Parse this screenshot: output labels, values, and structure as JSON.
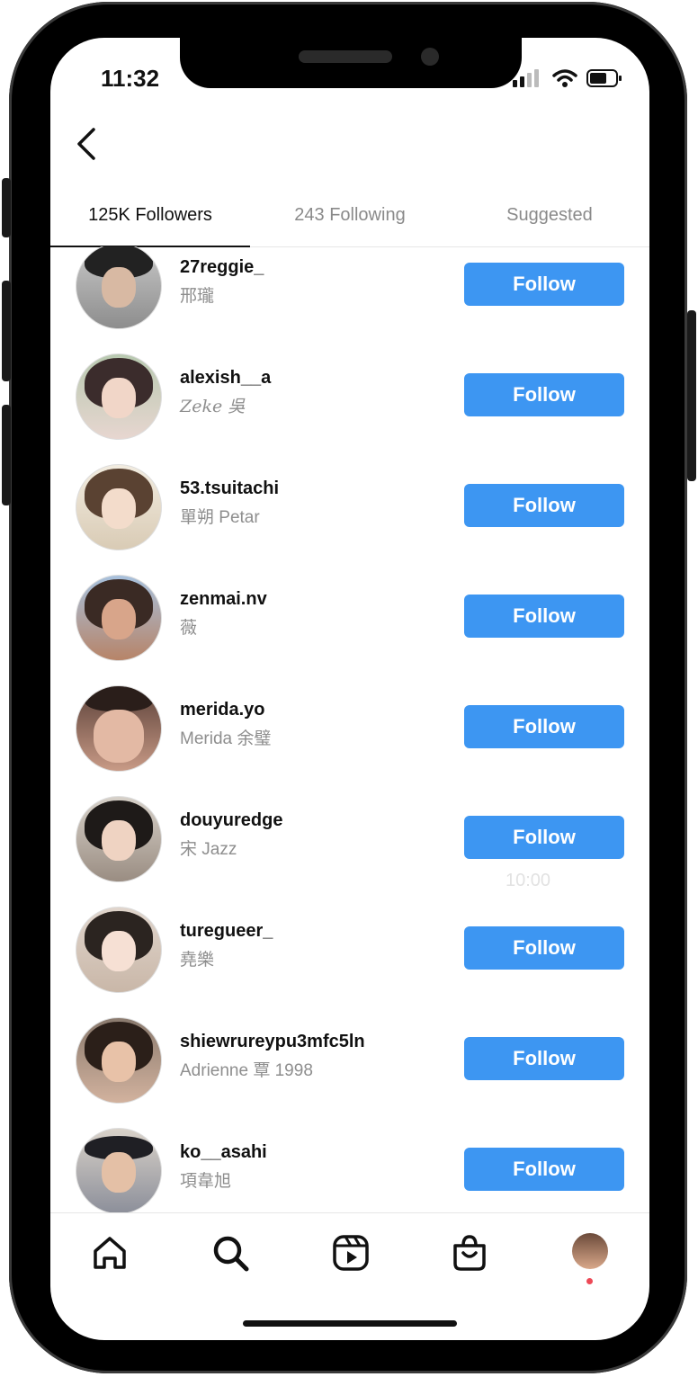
{
  "status_bar": {
    "time": "11:32"
  },
  "tabs": [
    {
      "label": "125K Followers",
      "active": true
    },
    {
      "label": "243 Following",
      "active": false
    },
    {
      "label": "Suggested",
      "active": false
    }
  ],
  "follow_label": "Follow",
  "ghost_overlay_text": "10:00",
  "rows": [
    {
      "username": "27reggie_",
      "fullname": "邢瓏"
    },
    {
      "username": "alexish__a",
      "fullname": "Zeke 吳"
    },
    {
      "username": "53.tsuitachi",
      "fullname": "單朔 Petar"
    },
    {
      "username": "zenmai.nv",
      "fullname": "薇"
    },
    {
      "username": "merida.yo",
      "fullname": "Merida 余璧"
    },
    {
      "username": "douyuredge",
      "fullname": "宋 Jazz"
    },
    {
      "username": "turegueer_",
      "fullname": "堯樂"
    },
    {
      "username": "shiewrureypu3mfc5ln",
      "fullname": "Adrienne 覃 1998"
    },
    {
      "username": "ko__asahi",
      "fullname": "項韋旭"
    }
  ],
  "icons": {
    "back": "chevron-left-icon",
    "signal": "cellular-signal-icon",
    "wifi": "wifi-icon",
    "battery": "battery-icon",
    "home": "home-icon",
    "search": "search-icon",
    "reels": "reels-icon",
    "shop": "shopping-bag-icon",
    "profile": "profile-avatar"
  },
  "colors": {
    "follow_button": "#3d96f2",
    "notification_dot": "#ed4956"
  }
}
